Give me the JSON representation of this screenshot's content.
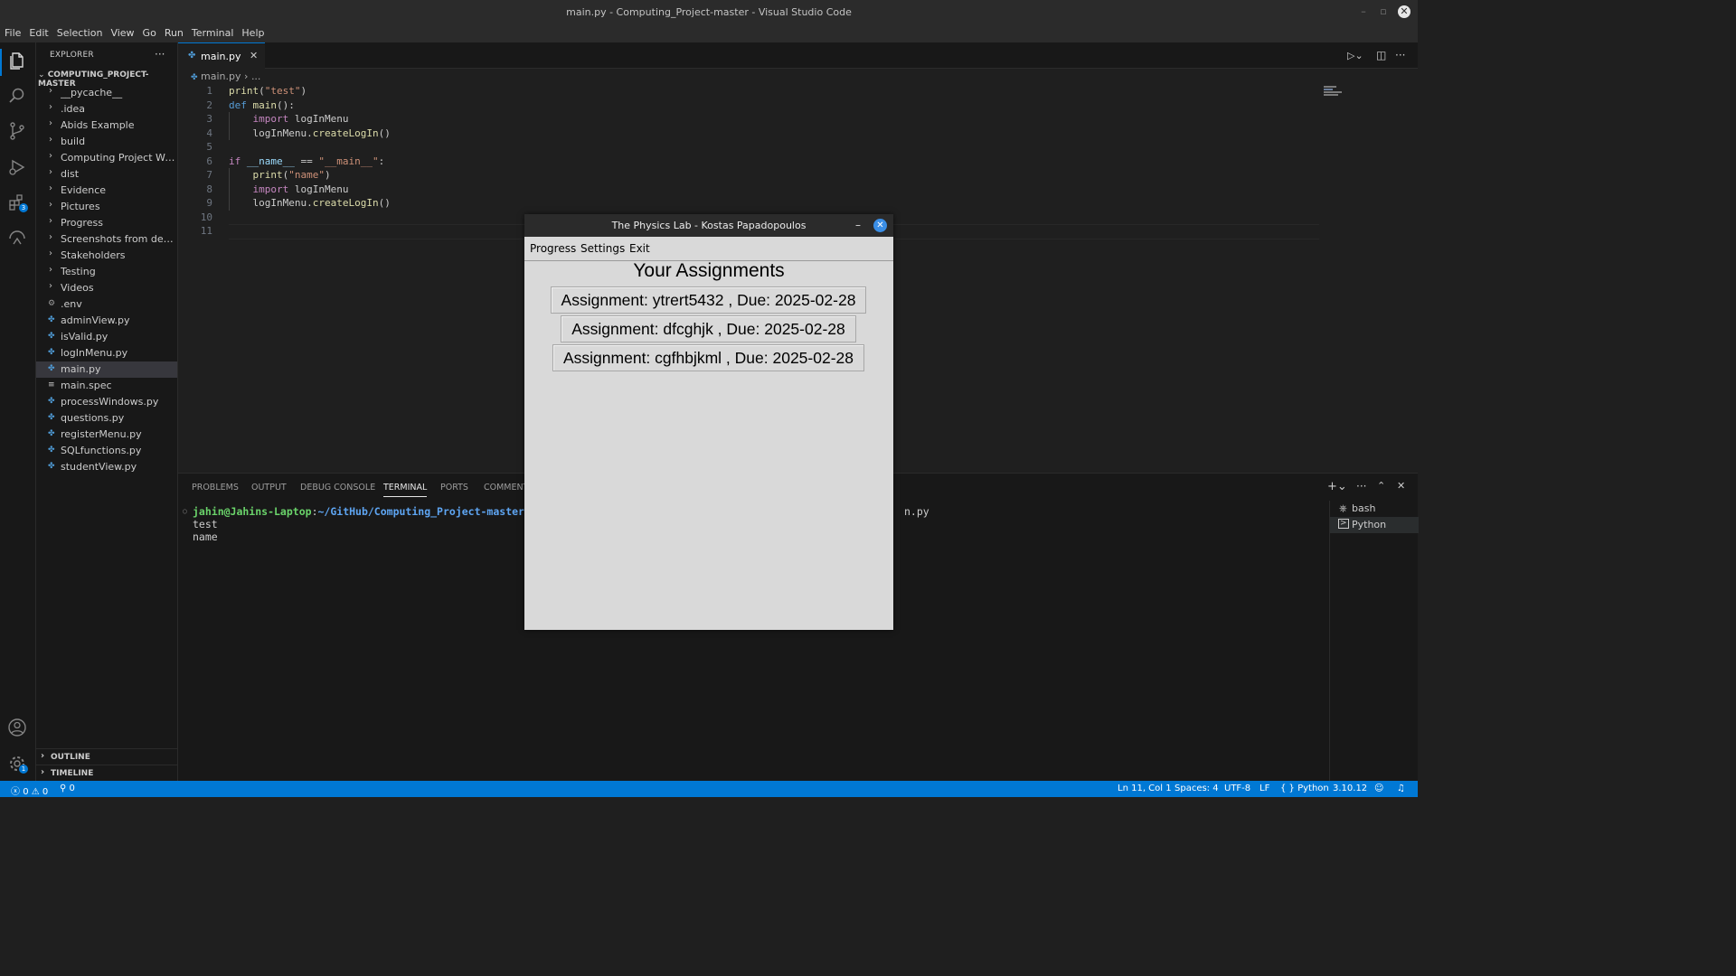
{
  "window": {
    "title": "main.py - Computing_Project-master - Visual Studio Code"
  },
  "menubar": [
    "File",
    "Edit",
    "Selection",
    "View",
    "Go",
    "Run",
    "Terminal",
    "Help"
  ],
  "activity_bar": {
    "extensions_badge": "3",
    "settings_badge": "1"
  },
  "sidebar": {
    "header": "EXPLORER",
    "root": "COMPUTING_PROJECT-MASTER",
    "folders": [
      "__pycache__",
      ".idea",
      "Abids Example",
      "build",
      "Computing Project Writ...",
      "dist",
      "Evidence",
      "Pictures",
      "Progress",
      "Screenshots from devel...",
      "Stakeholders",
      "Testing",
      "Videos"
    ],
    "files": [
      ".env",
      "adminView.py",
      "isValid.py",
      "logInMenu.py",
      "main.py",
      "main.spec",
      "processWindows.py",
      "questions.py",
      "registerMenu.py",
      "SQLfunctions.py",
      "studentView.py"
    ],
    "selected_file": "main.py",
    "sections": [
      "OUTLINE",
      "TIMELINE"
    ]
  },
  "editor": {
    "tab": "main.py",
    "breadcrumb": [
      "main.py",
      "..."
    ],
    "lines": [
      "print(\"test\")",
      "def main():",
      "    import logInMenu",
      "    logInMenu.createLogIn()",
      "",
      "if __name__ == \"__main__\":",
      "    print(\"name\")",
      "    import logInMenu",
      "    logInMenu.createLogIn()",
      "",
      ""
    ],
    "line_numbers": [
      "1",
      "2",
      "3",
      "4",
      "5",
      "6",
      "7",
      "8",
      "9",
      "10",
      "11"
    ]
  },
  "panel": {
    "tabs": [
      "PROBLEMS",
      "OUTPUT",
      "DEBUG CONSOLE",
      "TERMINAL",
      "PORTS",
      "COMMENTS"
    ],
    "active_tab": "TERMINAL",
    "prompt_user": "jahin@Jahins-Laptop",
    "prompt_path": "~/GitHub/Computing_Project-master",
    "prompt_tail": "$ /",
    "prompt_end": "n.py",
    "output": [
      "test",
      "name"
    ],
    "terminals": [
      "bash",
      "Python"
    ]
  },
  "statusbar": {
    "errors": "0",
    "warnings": "0",
    "ports": "0",
    "position": "Ln 11, Col 1",
    "spaces": "Spaces: 4",
    "encoding": "UTF-8",
    "eol": "LF",
    "language": "Python",
    "version": "3.10.12"
  },
  "dialog": {
    "title": "The Physics Lab - Kostas Papadopoulos",
    "menu": [
      "Progress",
      "Settings",
      "Exit"
    ],
    "heading": "Your Assignments",
    "assignments": [
      "Assignment: ytrert5432 , Due: 2025-02-28",
      "Assignment: dfcghjk , Due: 2025-02-28",
      "Assignment: cgfhbjkml , Due: 2025-02-28"
    ]
  }
}
